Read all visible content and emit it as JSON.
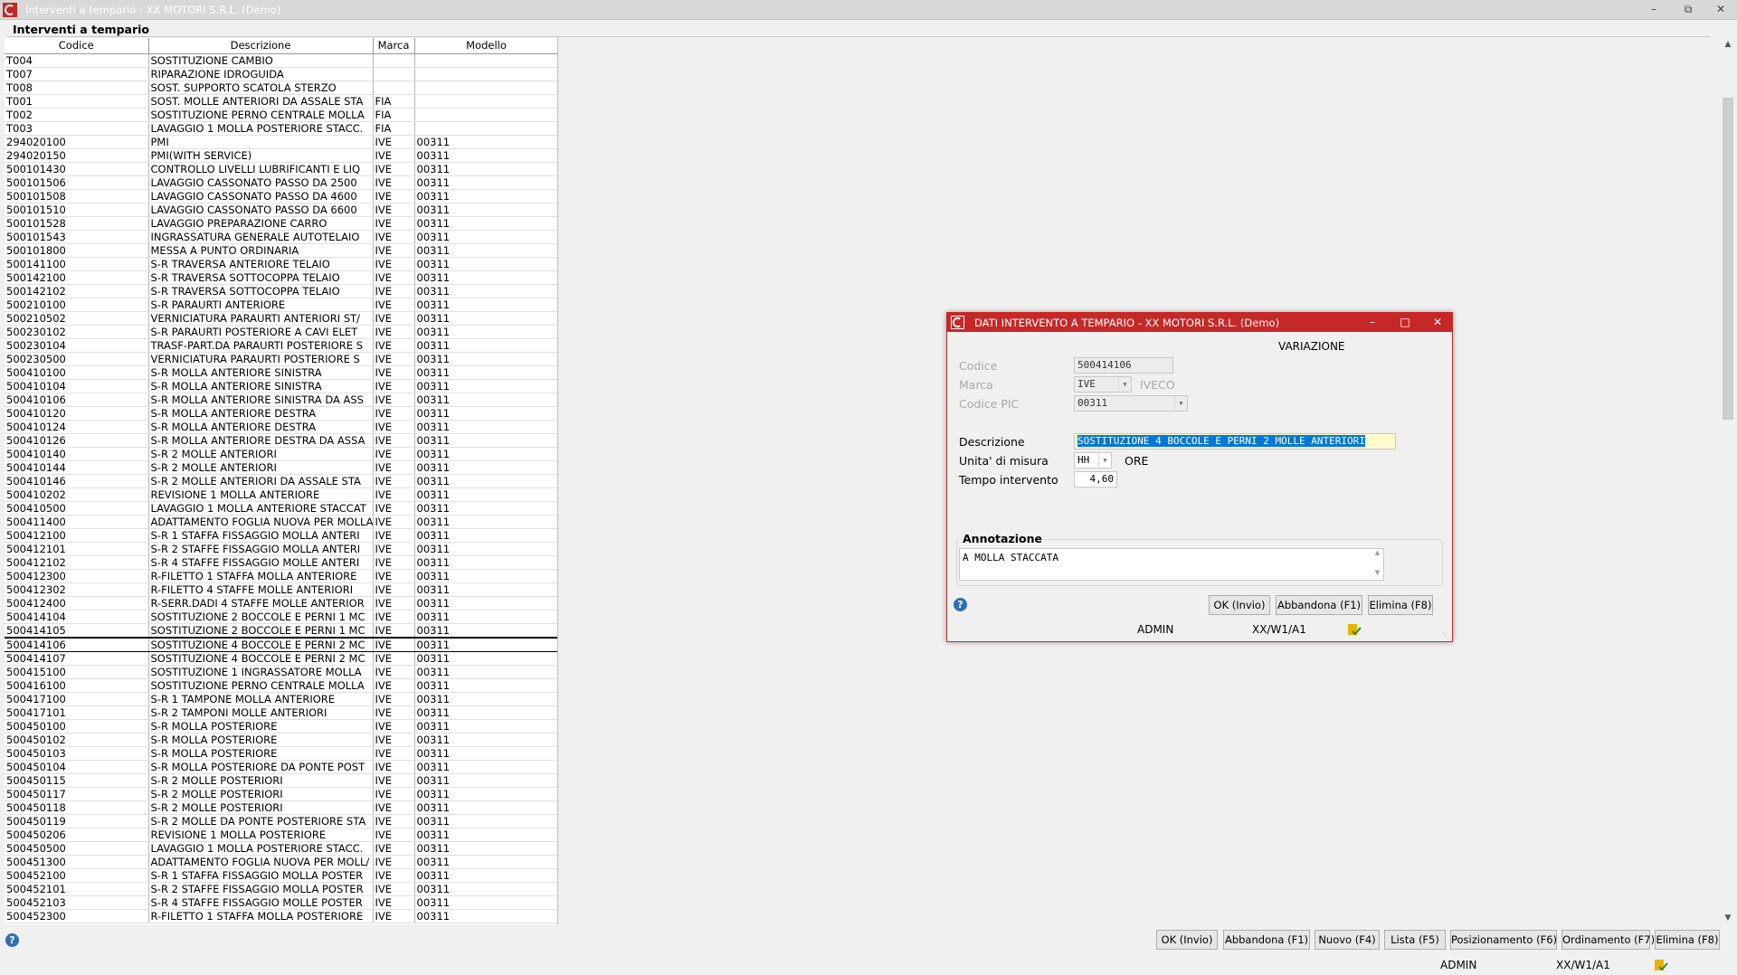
{
  "window": {
    "title": "Interventi a tempario  - XX  MOTORI S.R.L.  (Demo)"
  },
  "frame": {
    "label": "Interventi a tempario"
  },
  "grid": {
    "columns": [
      "Codice",
      "Descrizione",
      "Marca",
      "Modello"
    ],
    "rows": [
      [
        "T004",
        "SOSTITUZIONE CAMBIO",
        "",
        ""
      ],
      [
        "T007",
        "RIPARAZIONE IDROGUIDA",
        "",
        ""
      ],
      [
        "T008",
        "SOST. SUPPORTO SCATOLA STERZO",
        "",
        ""
      ],
      [
        "T001",
        "SOST. MOLLE ANTERIORI DA ASSALE STA",
        "FIA",
        ""
      ],
      [
        "T002",
        "SOSTITUZIONE PERNO CENTRALE MOLLA",
        "FIA",
        ""
      ],
      [
        "T003",
        "LAVAGGIO 1 MOLLA POSTERIORE STACC.",
        "FIA",
        ""
      ],
      [
        "294020100",
        "PMI",
        "IVE",
        "00311"
      ],
      [
        "294020150",
        "PMI(WITH SERVICE)",
        "IVE",
        "00311"
      ],
      [
        "500101430",
        "CONTROLLO LIVELLI LUBRIFICANTI E LIQ",
        "IVE",
        "00311"
      ],
      [
        "500101506",
        "LAVAGGIO CASSONATO PASSO DA 2500",
        "IVE",
        "00311"
      ],
      [
        "500101508",
        "LAVAGGIO CASSONATO PASSO DA 4600",
        "IVE",
        "00311"
      ],
      [
        "500101510",
        "LAVAGGIO CASSONATO PASSO DA 6600",
        "IVE",
        "00311"
      ],
      [
        "500101528",
        "LAVAGGIO PREPARAZIONE CARRO",
        "IVE",
        "00311"
      ],
      [
        "500101543",
        "INGRASSATURA GENERALE AUTOTELAIO",
        "IVE",
        "00311"
      ],
      [
        "500101800",
        "MESSA A PUNTO ORDINARIA",
        "IVE",
        "00311"
      ],
      [
        "500141100",
        "S-R TRAVERSA ANTERIORE TELAIO",
        "IVE",
        "00311"
      ],
      [
        "500142100",
        "S-R TRAVERSA SOTTOCOPPA TELAIO",
        "IVE",
        "00311"
      ],
      [
        "500142102",
        "S-R TRAVERSA SOTTOCOPPA TELAIO",
        "IVE",
        "00311"
      ],
      [
        "500210100",
        "S-R PARAURTI ANTERIORE",
        "IVE",
        "00311"
      ],
      [
        "500210502",
        "VERNICIATURA PARAURTI ANTERIORI ST/",
        "IVE",
        "00311"
      ],
      [
        "500230102",
        "S-R PARAURTI POSTERIORE A CAVI ELET",
        "IVE",
        "00311"
      ],
      [
        "500230104",
        "TRASF-PART.DA PARAURTI POSTERIORE S",
        "IVE",
        "00311"
      ],
      [
        "500230500",
        "VERNICIATURA PARAURTI POSTERIORE S",
        "IVE",
        "00311"
      ],
      [
        "500410100",
        "S-R MOLLA ANTERIORE SINISTRA",
        "IVE",
        "00311"
      ],
      [
        "500410104",
        "S-R MOLLA ANTERIORE SINISTRA",
        "IVE",
        "00311"
      ],
      [
        "500410106",
        "S-R MOLLA ANTERIORE SINISTRA DA ASS",
        "IVE",
        "00311"
      ],
      [
        "500410120",
        "S-R MOLLA ANTERIORE DESTRA",
        "IVE",
        "00311"
      ],
      [
        "500410124",
        "S-R MOLLA ANTERIORE DESTRA",
        "IVE",
        "00311"
      ],
      [
        "500410126",
        "S-R MOLLA ANTERIORE DESTRA DA ASSA",
        "IVE",
        "00311"
      ],
      [
        "500410140",
        "S-R 2 MOLLE ANTERIORI",
        "IVE",
        "00311"
      ],
      [
        "500410144",
        "S-R 2 MOLLE ANTERIORI",
        "IVE",
        "00311"
      ],
      [
        "500410146",
        "S-R 2 MOLLE ANTERIORI DA ASSALE STA",
        "IVE",
        "00311"
      ],
      [
        "500410202",
        "REVISIONE 1 MOLLA ANTERIORE",
        "IVE",
        "00311"
      ],
      [
        "500410500",
        "LAVAGGIO 1 MOLLA ANTERIORE STACCAT",
        "IVE",
        "00311"
      ],
      [
        "500411400",
        "ADATTAMENTO FOGLIA NUOVA PER MOLLA",
        "IVE",
        "00311"
      ],
      [
        "500412100",
        "S-R 1 STAFFA FISSAGGIO MOLLA ANTERI",
        "IVE",
        "00311"
      ],
      [
        "500412101",
        "S-R 2 STAFFE FISSAGGIO MOLLA ANTERI",
        "IVE",
        "00311"
      ],
      [
        "500412102",
        "S-R 4 STAFFE FISSAGGIO MOLLE ANTERI",
        "IVE",
        "00311"
      ],
      [
        "500412300",
        "R-FILETTO 1 STAFFA MOLLA ANTERIORE",
        "IVE",
        "00311"
      ],
      [
        "500412302",
        "R-FILETTO 4 STAFFE MOLLE ANTERIORI",
        "IVE",
        "00311"
      ],
      [
        "500412400",
        "R-SERR.DADI 4 STAFFE MOLLE ANTERIOR",
        "IVE",
        "00311"
      ],
      [
        "500414104",
        "SOSTITUZIONE 2 BOCCOLE E PERNI 1 MC",
        "IVE",
        "00311"
      ],
      [
        "500414105",
        "SOSTITUZIONE 2 BOCCOLE E PERNI 1 MC",
        "IVE",
        "00311"
      ],
      [
        "500414106",
        "SOSTITUZIONE 4 BOCCOLE E PERNI 2 MC",
        "IVE",
        "00311"
      ],
      [
        "500414107",
        "SOSTITUZIONE 4 BOCCOLE E PERNI 2 MC",
        "IVE",
        "00311"
      ],
      [
        "500415100",
        "SOSTITUZIONE 1 INGRASSATORE MOLLA",
        "IVE",
        "00311"
      ],
      [
        "500416100",
        "SOSTITUZIONE PERNO CENTRALE MOLLA",
        "IVE",
        "00311"
      ],
      [
        "500417100",
        "S-R 1 TAMPONE MOLLA ANTERIORE",
        "IVE",
        "00311"
      ],
      [
        "500417101",
        "S-R 2 TAMPONI MOLLE ANTERIORI",
        "IVE",
        "00311"
      ],
      [
        "500450100",
        "S-R MOLLA POSTERIORE",
        "IVE",
        "00311"
      ],
      [
        "500450102",
        "S-R MOLLA POSTERIORE",
        "IVE",
        "00311"
      ],
      [
        "500450103",
        "S-R MOLLA POSTERIORE",
        "IVE",
        "00311"
      ],
      [
        "500450104",
        "S-R MOLLA POSTERIORE DA PONTE POST",
        "IVE",
        "00311"
      ],
      [
        "500450115",
        "S-R 2 MOLLE POSTERIORI",
        "IVE",
        "00311"
      ],
      [
        "500450117",
        "S-R 2 MOLLE POSTERIORI",
        "IVE",
        "00311"
      ],
      [
        "500450118",
        "S-R 2 MOLLE POSTERIORI",
        "IVE",
        "00311"
      ],
      [
        "500450119",
        "S-R 2 MOLLE DA PONTE POSTERIORE STA",
        "IVE",
        "00311"
      ],
      [
        "500450206",
        "REVISIONE 1 MOLLA POSTERIORE",
        "IVE",
        "00311"
      ],
      [
        "500450500",
        "LAVAGGIO 1 MOLLA POSTERIORE STACC.",
        "IVE",
        "00311"
      ],
      [
        "500451300",
        "ADATTAMENTO FOGLIA NUOVA PER MOLL/",
        "IVE",
        "00311"
      ],
      [
        "500452100",
        "S-R 1 STAFFA FISSAGGIO MOLLA POSTER",
        "IVE",
        "00311"
      ],
      [
        "500452101",
        "S-R 2 STAFFE FISSAGGIO MOLLA POSTER",
        "IVE",
        "00311"
      ],
      [
        "500452103",
        "S-R 4 STAFFE FISSAGGIO MOLLE POSTER",
        "IVE",
        "00311"
      ],
      [
        "500452300",
        "R-FILETTO 1 STAFFA MOLLA POSTERIORE",
        "IVE",
        "00311"
      ]
    ],
    "selected_code": "500414106"
  },
  "toolbar": {
    "ok": "OK (Invio)",
    "abbandona": "Abbandona (F1)",
    "nuovo": "Nuovo (F4)",
    "lista": "Lista (F5)",
    "posizionamento": "Posizionamento (F6)",
    "ordinamento": "Ordinamento (F7)",
    "elimina": "Elimina (F8)"
  },
  "status": {
    "user": "ADMIN",
    "system": "XX/W1/A1"
  },
  "dialog": {
    "title": "DATI INTERVENTO A TEMPARIO  - XX  MOTORI S.R.L.  (Demo)",
    "mode": "VARIAZIONE",
    "codice_label": "Codice",
    "codice_value": "500414106",
    "marca_label": "Marca",
    "marca_value": "IVE",
    "marca_desc": "IVECO",
    "codice_pic_label": "Codice PIC",
    "codice_pic_value": "00311",
    "descrizione_label": "Descrizione",
    "descrizione_value": "SOSTITUZIONE 4 BOCCOLE E PERNI 2 MOLLE ANTERIORI",
    "unita_label": "Unita' di misura",
    "unita_value": "HH",
    "unita_desc": "ORE",
    "tempo_label": "Tempo intervento",
    "tempo_value": "4,60",
    "annotazione_label": "Annotazione",
    "annotazione_value": "A MOLLA STACCATA",
    "ok": "OK (Invio)",
    "abbandona": "Abbandona (F1)",
    "elimina": "Elimina (F8)",
    "user": "ADMIN",
    "system": "XX/W1/A1"
  },
  "colors": {
    "accent": "#c62828",
    "selection": "#0078d7",
    "help": "#2f6fb3"
  }
}
